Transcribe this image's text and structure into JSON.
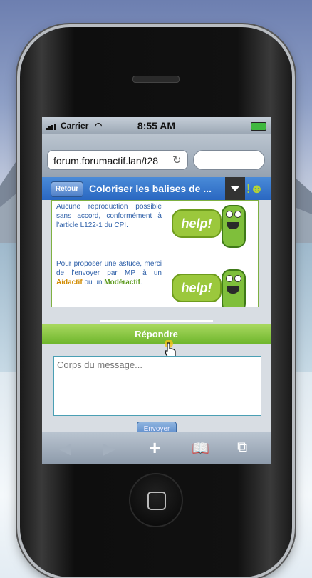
{
  "status": {
    "carrier": "Carrier",
    "time": "8:55 AM"
  },
  "browser": {
    "url": "forum.forumactif.lan/t28",
    "search_placeholder": ""
  },
  "nav": {
    "back_label": "Retour",
    "title": "Coloriser les balises de ..."
  },
  "post": {
    "para1": "Aucune reproduction possible sans accord, conformément à l'article L122-1 du CPI.",
    "para2_prefix": "Pour proposer une astuce, merci de l'envoyer par MP à un",
    "aidactif": "Aidactif",
    "ou": "ou un",
    "moderactif": "Modéractif",
    "help_text": "help!"
  },
  "reply": {
    "button": "Répondre",
    "placeholder": "Corps du message...",
    "send": "Envoyer"
  },
  "colors": {
    "nav_blue": "#2a67c1",
    "reply_green": "#6db52b",
    "link_blue": "#2d5fa8"
  },
  "icons": [
    "signal-icon",
    "wifi-icon",
    "battery-icon",
    "reload-icon",
    "dropdown-icon",
    "back-arrow-icon",
    "forward-arrow-icon",
    "add-icon",
    "bookmarks-icon",
    "pages-icon",
    "home-button-icon"
  ]
}
